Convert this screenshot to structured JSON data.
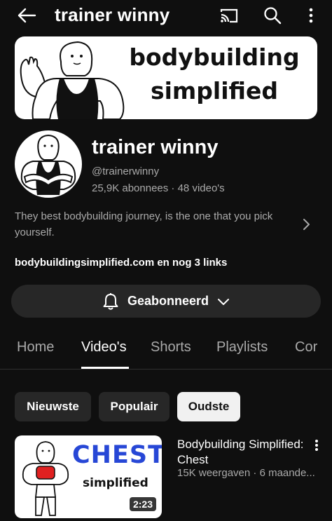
{
  "header": {
    "title": "trainer winny",
    "icons": [
      "back-arrow-icon",
      "cast-icon",
      "search-icon",
      "more-vertical-icon"
    ]
  },
  "banner": {
    "line1": "bodybuilding",
    "line2": "simplified"
  },
  "channel": {
    "name": "trainer winny",
    "handle": "@trainerwinny",
    "stats": "25,9K abonnees · 48 video's",
    "description": "They best bodybuilding journey, is the one that you pick yourself.",
    "links": "bodybuildingsimplified.com en nog 3 links"
  },
  "subscribe": {
    "label": "Geabonneerd"
  },
  "tabs": [
    {
      "label": "Home"
    },
    {
      "label": "Video's",
      "active": true
    },
    {
      "label": "Shorts"
    },
    {
      "label": "Playlists"
    },
    {
      "label": "Cor"
    }
  ],
  "chips": [
    {
      "label": "Nieuwste"
    },
    {
      "label": "Populair"
    },
    {
      "label": "Oudste",
      "selected": true
    }
  ],
  "video": {
    "thumb_title": "CHEST",
    "thumb_sub": "simplified",
    "duration": "2:23",
    "title": "Bodybuilding Simplified: Chest",
    "meta": "15K weergaven · 6 maande..."
  },
  "colors": {
    "background": "#0f0f0f",
    "chip": "#272727",
    "chip_selected": "#f1f1f1",
    "secondary_text": "#aaaaaa",
    "thumb_title": "#2747d6"
  }
}
